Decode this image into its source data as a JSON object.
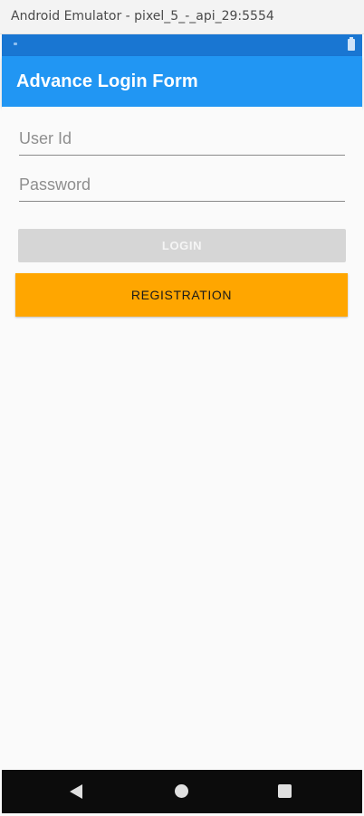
{
  "window": {
    "title": "Android Emulator - pixel_5_-_api_29:5554"
  },
  "status_bar": {
    "icons": [
      "signal-dot-icon",
      "battery-icon"
    ],
    "color": "#1976d2"
  },
  "app_bar": {
    "title": "Advance Login Form",
    "color": "#2196f3"
  },
  "form": {
    "user_id": {
      "placeholder": "User Id",
      "value": ""
    },
    "password": {
      "placeholder": "Password",
      "value": ""
    },
    "login_button": {
      "label": "LOGIN",
      "color": "#d6d6d6",
      "state": "disabled"
    },
    "registration_button": {
      "label": "REGISTRATION",
      "color": "#ffa600"
    }
  },
  "nav_bar": {
    "icons": [
      "back-icon",
      "home-icon",
      "recents-icon"
    ]
  }
}
